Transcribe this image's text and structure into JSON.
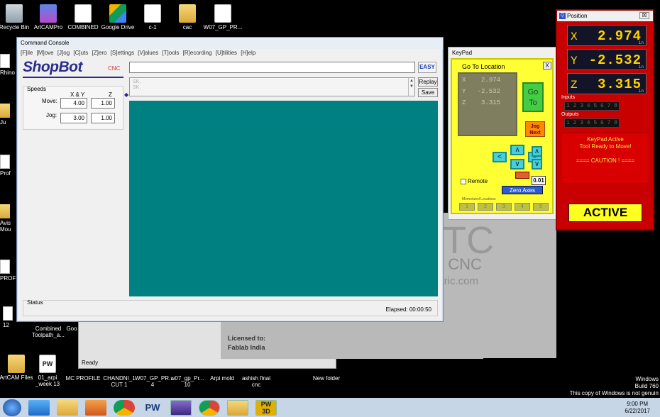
{
  "desktop": {
    "top_icons": [
      {
        "label": "Recycle Bin",
        "kind": "bin"
      },
      {
        "label": "ArtCAMPro",
        "kind": "art"
      },
      {
        "label": "COMBINED",
        "kind": "doc"
      },
      {
        "label": "Google Drive",
        "kind": "drive"
      },
      {
        "label": "c-1",
        "kind": "doc"
      },
      {
        "label": "cac",
        "kind": "folder"
      },
      {
        "label": "W07_GP_PR...",
        "kind": "doc"
      }
    ],
    "left_icons": [
      "Rhino",
      "Ju",
      "Prof",
      "Avis Mou",
      "PROF",
      "12"
    ],
    "mid_left_labels": [
      "Combined Toolpath_a...",
      "Goo"
    ],
    "bottom_icons": [
      {
        "label": "ArtCAM Files",
        "kind": "folder"
      },
      {
        "label": "01_arpi _week 13",
        "kind": "pw"
      },
      {
        "label": "MC PROFILE",
        "kind": "none"
      },
      {
        "label": "CHANDNI_1 CUT 1",
        "kind": "none"
      },
      {
        "label": "W07_GP_PR... 4",
        "kind": "none"
      },
      {
        "label": "w07_gp_Pr... 10",
        "kind": "none"
      },
      {
        "label": "Arpi mold",
        "kind": "none"
      },
      {
        "label": "ashish final cnc",
        "kind": "none"
      },
      {
        "label": "New folder",
        "kind": "none"
      }
    ]
  },
  "background_app": {
    "brand_big": "TC",
    "brand_cnc": "t CNC",
    "brand_url": "ctric.com",
    "license_label": "Licensed to:",
    "license_name": "Fablab India",
    "status": "Ready"
  },
  "console": {
    "title": "Command Console",
    "menu": [
      "[F]ile",
      "[M]ove",
      "[J]og",
      "[C]uts",
      "[Z]ero",
      "[S]ettings",
      "[V]alues",
      "[T]ools",
      "[R]ecording",
      "[U]tilities",
      "[H]elp"
    ],
    "logo": "ShopBot",
    "logo_sub": "CNC",
    "easy_button": "EASY",
    "history_lines": [
      "SK,",
      "SK,"
    ],
    "replay_button": "Replay",
    "save_button": "Save",
    "speeds_title": "Speeds",
    "col_xy": "X & Y",
    "col_z": "Z",
    "move_label": "Move:",
    "jog_label": "Jog:",
    "move_xy": "4.00",
    "move_z": "1.00",
    "jog_xy": "3.00",
    "jog_z": "1.00",
    "status_title": "Status",
    "elapsed": "Elapsed: 00:00:50"
  },
  "keypad": {
    "title": "KeyPad",
    "goto_title": "Go To Location",
    "close": "X",
    "display": [
      {
        "axis": "X",
        "value": "2.974"
      },
      {
        "axis": "Y",
        "value": "-2.532"
      },
      {
        "axis": "Z",
        "value": "3.315"
      }
    ],
    "goto_button": "Go To",
    "jog_next": "Jog Next",
    "remote": "Remote",
    "step_value": "0.01",
    "zero_axes": "Zero Axes",
    "memorized_label": "Memorized Locations",
    "memorized": [
      "1",
      "2",
      "3",
      "4",
      "5"
    ]
  },
  "position": {
    "title": "Position",
    "axes": [
      {
        "name": "X",
        "value": "2.974",
        "unit": "in"
      },
      {
        "name": "Y",
        "value": "-2.532",
        "unit": "in"
      },
      {
        "name": "Z",
        "value": "3.315",
        "unit": "in"
      }
    ],
    "inputs_label": "Inputs",
    "inputs": "1 2 3 4 5 6 7 8",
    "outputs_label": "Outputs",
    "outputs": "1 2 3 4 5 6 7 8",
    "status_line1": "KeyPad Active",
    "status_line2": "Tool Ready to Move!",
    "caution": "==== CAUTION ! ====",
    "active": "ACTIVE"
  },
  "taskbar": {
    "time": "9:00 PM",
    "date": "6/22/2017"
  },
  "watermark": {
    "line1": "Windows",
    "line2": "Build 760",
    "line3": "This copy of Windows is not genuin"
  },
  "colors": {
    "teal_canvas": "#008080",
    "keypad_yellow": "#ffff33",
    "position_red": "#c80000",
    "readout_yellow": "#ffd200"
  }
}
